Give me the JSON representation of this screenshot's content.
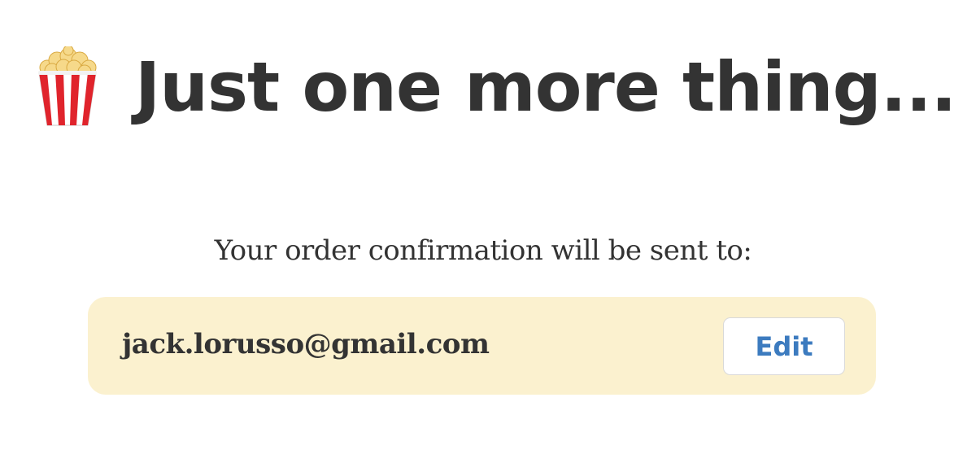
{
  "header": {
    "icon": "popcorn-icon",
    "title": "Just one more thing..."
  },
  "confirmation": {
    "message": "Your order confirmation will be sent to:",
    "email": "jack.lorusso@gmail.com",
    "edit_label": "Edit"
  },
  "colors": {
    "text": "#333333",
    "email_box_background": "#fbf1cf",
    "edit_label": "#3c7bbf"
  }
}
